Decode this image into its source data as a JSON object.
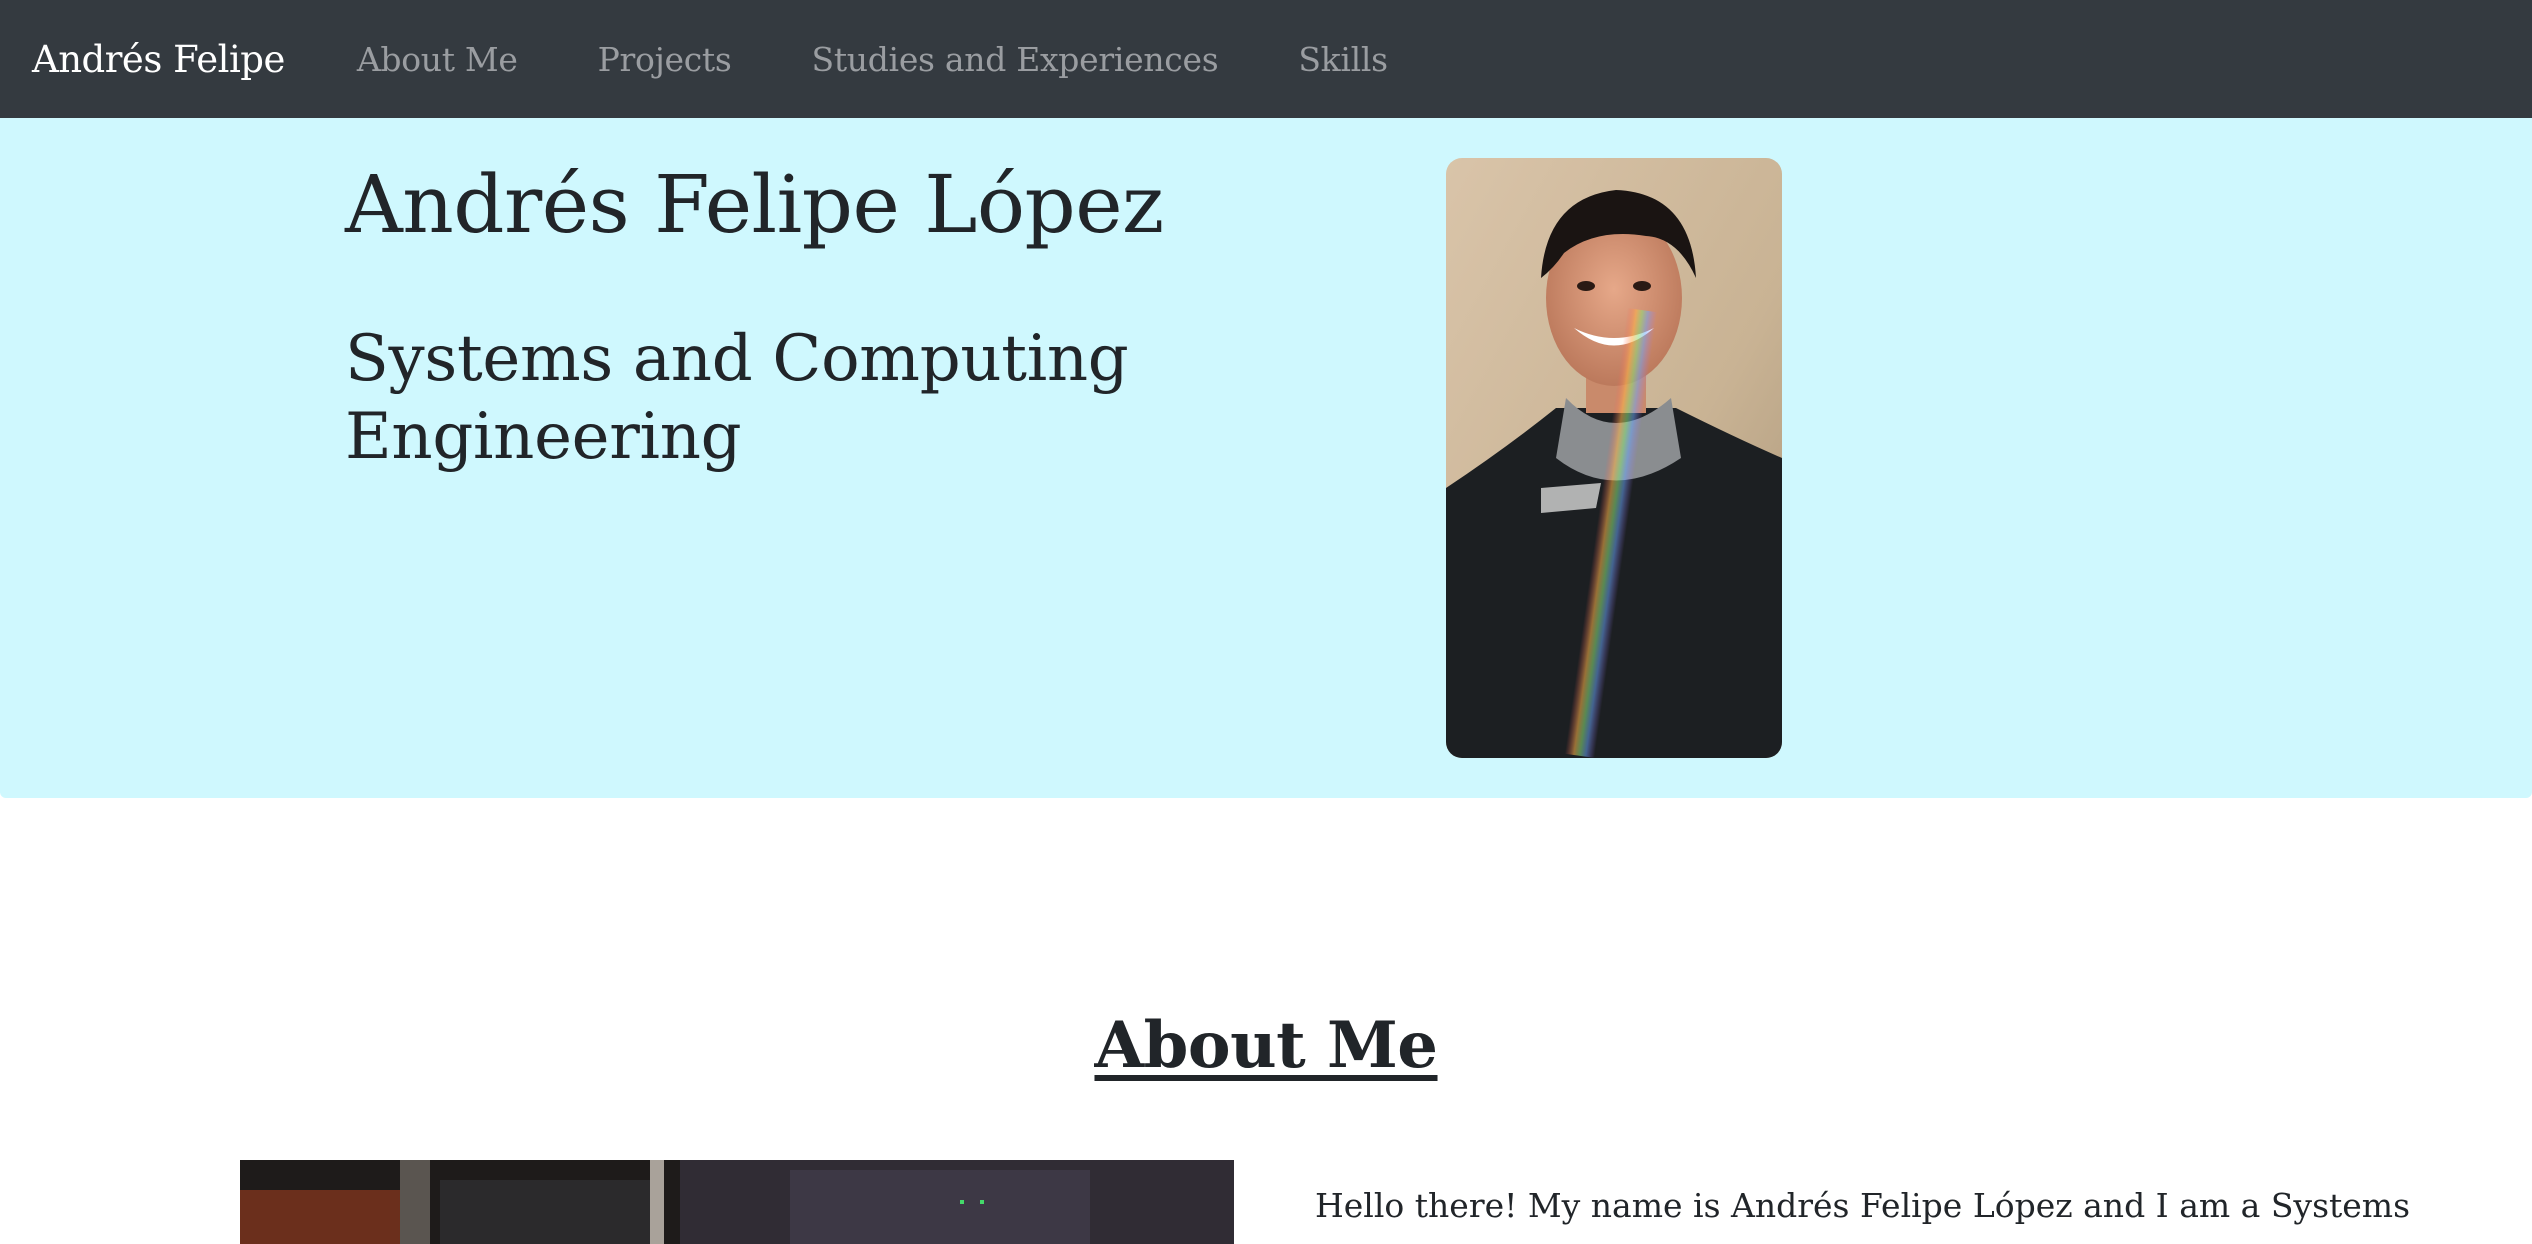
{
  "navbar": {
    "brand": "Andrés Felipe",
    "links": [
      "About Me",
      "Projects",
      "Studies and Experiences",
      "Skills"
    ]
  },
  "hero": {
    "name": "Andrés Felipe López",
    "subtitle": "Systems and Computing Engineering",
    "background_color": "#cff8fe"
  },
  "about": {
    "title": "About Me",
    "intro": "Hello there! My name is Andrés Felipe López and I am a Systems and"
  },
  "colors": {
    "navbar_bg": "#343a40",
    "brand_text": "#ffffff",
    "nav_link_text": "#9a9da1",
    "body_text": "#212529"
  }
}
